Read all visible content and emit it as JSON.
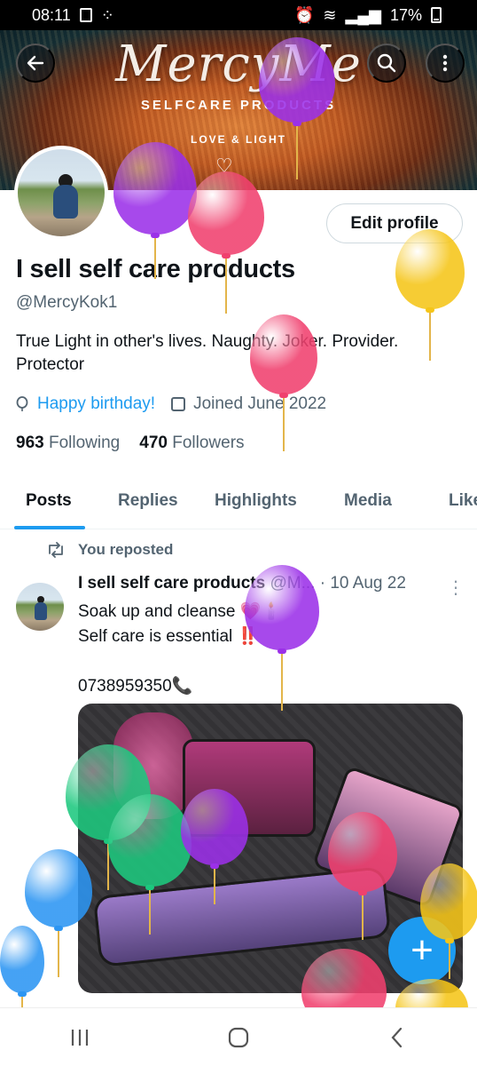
{
  "status_bar": {
    "time": "08:11",
    "battery": "17%"
  },
  "banner": {
    "logo": "MercyMe",
    "tagline": "SELFCARE PRODUCTS",
    "tagline2": "LOVE & LIGHT"
  },
  "profile": {
    "edit_label": "Edit profile",
    "display_name": "I sell self care products",
    "handle": "@MercyKok1",
    "bio": "True Light in other's lives. Naughty. Joker. Provider. Protector",
    "birthday": "Happy birthday!",
    "joined": "Joined June 2022",
    "following_count": "963",
    "following_label": "Following",
    "followers_count": "470",
    "followers_label": "Followers"
  },
  "tabs": [
    "Posts",
    "Replies",
    "Highlights",
    "Media",
    "Like"
  ],
  "post": {
    "repost_label": "You reposted",
    "author_name": "I sell self care products",
    "author_handle": "@M...",
    "date": "· 10 Aug 22",
    "text": "Soak up and cleanse 💗🕯️\nSelf care is essential ‼️\n\n0738959350📞"
  },
  "colors": {
    "accent": "#1d9bf0",
    "secondary_text": "#536471",
    "primary_text": "#0f1419"
  },
  "icons": [
    "back-arrow-icon",
    "search-icon",
    "more-vertical-icon",
    "balloon-icon",
    "calendar-icon",
    "repost-icon",
    "plus-icon",
    "recents-icon",
    "home-icon",
    "back-nav-icon"
  ]
}
